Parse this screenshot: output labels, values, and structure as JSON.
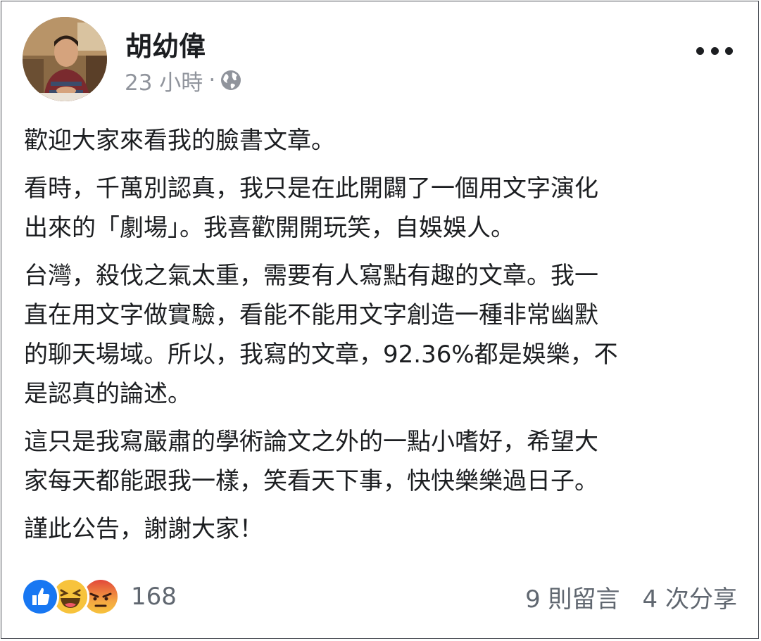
{
  "post": {
    "author": "胡幼偉",
    "time": "23 小時",
    "separator": "·",
    "privacy_icon": "globe-icon",
    "paragraphs": [
      [
        "歡迎大家來看我的臉書文章。"
      ],
      [
        "看時，千萬別認真，我只是在此開闢了一個用文字演化",
        "出來的「劇場」。我喜歡開開玩笑，自娛娛人。"
      ],
      [
        "台灣，殺伐之氣太重，需要有人寫點有趣的文章。我一",
        "直在用文字做實驗，看能不能用文字創造一種非常幽默",
        "的聊天場域。所以，我寫的文章，92.36%都是娛樂，不",
        "是認真的論述。"
      ],
      [
        "這只是我寫嚴肅的學術論文之外的一點小嗜好，希望大",
        "家每天都能跟我一樣，笑看天下事，快快樂樂過日子。"
      ],
      [
        "謹此公告，謝謝大家！"
      ]
    ]
  },
  "reactions": {
    "icons": [
      "like-icon",
      "haha-icon",
      "angry-icon"
    ],
    "count": "168"
  },
  "footer": {
    "comments": "9 則留言",
    "shares": "4 次分享"
  },
  "colors": {
    "like": "#1877f2",
    "haha": "#f7c33c",
    "angry": "#e8713d",
    "meta_text": "#90949c"
  }
}
